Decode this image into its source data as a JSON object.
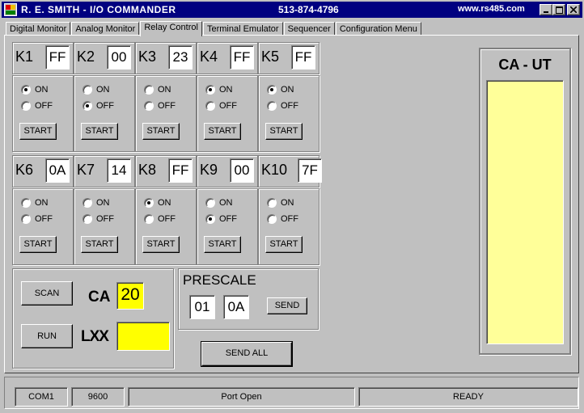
{
  "window": {
    "title": "R. E. SMITH  -  I/O COMMANDER",
    "phone": "513-874-4796",
    "url": "www.rs485.com",
    "minimize": "_",
    "maximize": "□",
    "close": "×"
  },
  "tabs": [
    {
      "label": "Digital Monitor"
    },
    {
      "label": "Analog Monitor"
    },
    {
      "label": "Relay Control",
      "active": true
    },
    {
      "label": "Terminal Emulator"
    },
    {
      "label": "Sequencer"
    },
    {
      "label": "Configuration Menu"
    }
  ],
  "relays": [
    {
      "name": "K1",
      "value": "FF",
      "state": "ON",
      "on_label": "ON",
      "off_label": "OFF",
      "start_label": "START"
    },
    {
      "name": "K2",
      "value": "00",
      "state": "OFF",
      "on_label": "ON",
      "off_label": "OFF",
      "start_label": "START"
    },
    {
      "name": "K3",
      "value": "23",
      "state": "",
      "on_label": "ON",
      "off_label": "OFF",
      "start_label": "START"
    },
    {
      "name": "K4",
      "value": "FF",
      "state": "ON",
      "on_label": "ON",
      "off_label": "OFF",
      "start_label": "START"
    },
    {
      "name": "K5",
      "value": "FF",
      "state": "ON",
      "on_label": "ON",
      "off_label": "OFF",
      "start_label": "START"
    },
    {
      "name": "K6",
      "value": "0A",
      "state": "",
      "on_label": "ON",
      "off_label": "OFF",
      "start_label": "START"
    },
    {
      "name": "K7",
      "value": "14",
      "state": "",
      "on_label": "ON",
      "off_label": "OFF",
      "start_label": "START"
    },
    {
      "name": "K8",
      "value": "FF",
      "state": "ON",
      "on_label": "ON",
      "off_label": "OFF",
      "start_label": "START"
    },
    {
      "name": "K9",
      "value": "00",
      "state": "OFF",
      "on_label": "ON",
      "off_label": "OFF",
      "start_label": "START"
    },
    {
      "name": "K10",
      "value": "7F",
      "state": "",
      "on_label": "ON",
      "off_label": "OFF",
      "start_label": "START"
    }
  ],
  "scan_group": {
    "scan_label": "SCAN",
    "run_label": "RUN",
    "ca_label": "CA",
    "ca_value": "20",
    "lxx_label": "LXX",
    "lxx_value": ""
  },
  "prescale": {
    "title": "PRESCALE",
    "value1": "01",
    "value2": "0A",
    "send_label": "SEND"
  },
  "send_all_label": "SEND ALL",
  "ca_ut": {
    "title": "CA - UT",
    "content": ""
  },
  "status": {
    "port": "COM1",
    "baud": "9600",
    "port_state": "Port Open",
    "ready": "READY"
  },
  "colors": {
    "titlebar": "#000080",
    "face": "#c0c0c0",
    "ca_field": "#ffff00",
    "ca_ut_panel": "#ffff99"
  }
}
